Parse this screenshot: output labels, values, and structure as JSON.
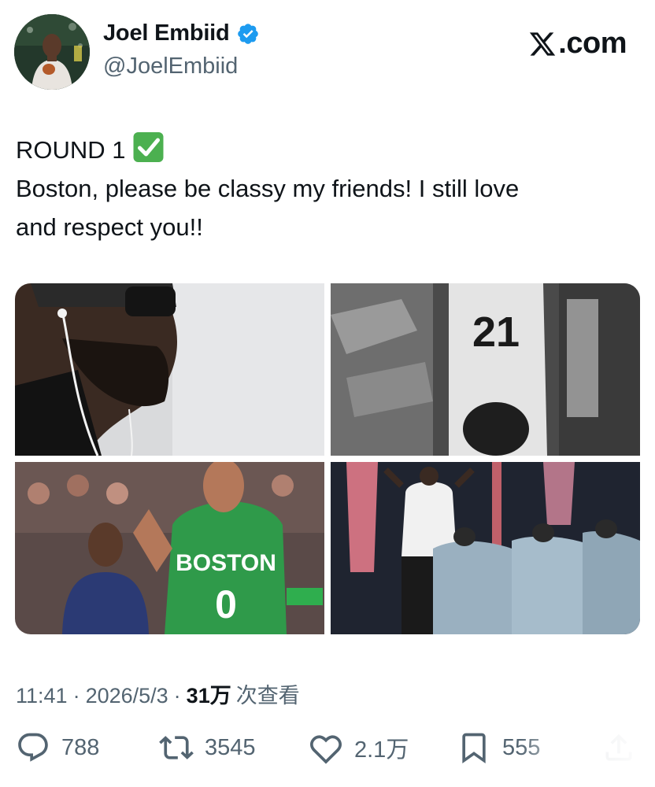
{
  "author": {
    "display_name": "Joel Embiid",
    "handle": "@JoelEmbiid",
    "verified": true,
    "avatar_icon": "profile-photo"
  },
  "brand": {
    "label": ".com",
    "logo_icon": "x-logo"
  },
  "tweet": {
    "line1": "ROUND 1",
    "line1_emoji": "check-mark-button-emoji",
    "line2": "Boston, please be classy my friends! I still love",
    "line3": "and respect you!!"
  },
  "media": {
    "photo1_icon": "photo-player-with-earphones",
    "photo2_icon": "photo-player-21-back",
    "photo2_text": "21",
    "photo3_icon": "photo-player-boston-0",
    "photo3_jersey": "BOSTON",
    "photo3_number": "0",
    "photo4_icon": "photo-arena-intro"
  },
  "meta": {
    "time": "11:41",
    "date": "2026/5/3",
    "separator": "·",
    "views_count": "31万",
    "views_label": "次查看"
  },
  "actions": {
    "reply_count": "788",
    "retweet_count": "3545",
    "like_count": "2.1万",
    "bookmark_count": "555"
  },
  "colors": {
    "text_primary": "#0f1419",
    "text_secondary": "#536471",
    "verified_blue": "#1d9bf0",
    "check_green": "#4cb050"
  }
}
